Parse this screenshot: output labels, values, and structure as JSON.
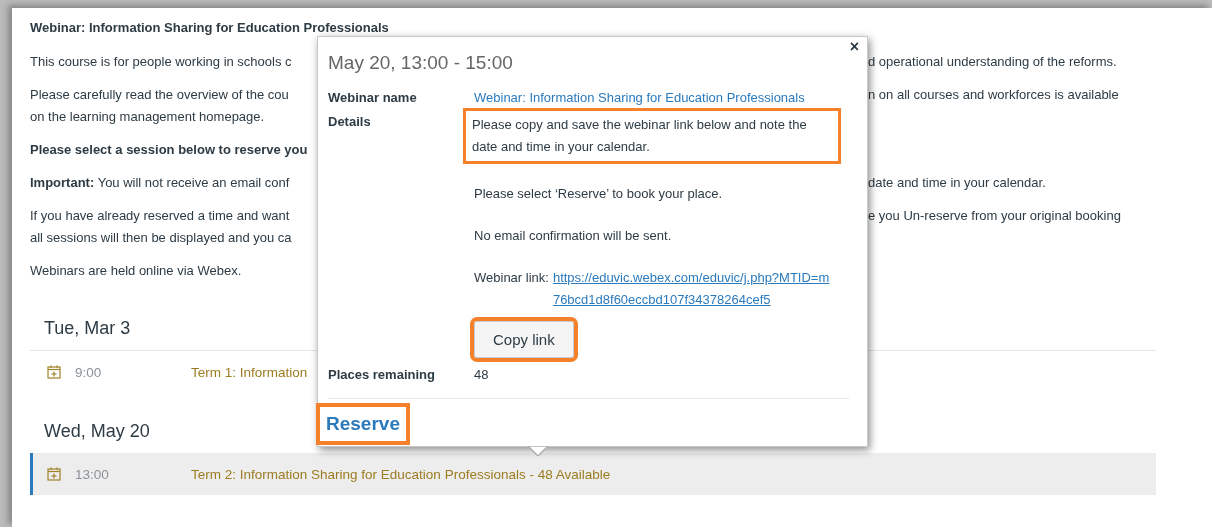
{
  "heading": "Webinar: Information Sharing for Education Professionals",
  "paragraphs": [
    {
      "kind": "plain",
      "left_lines": [
        "This course is for people working in schools c"
      ],
      "right_lines": [
        "d operational understanding of the reforms."
      ]
    },
    {
      "kind": "plain",
      "left_lines": [
        "Please carefully read the overview of the cou",
        "on the learning management homepage."
      ],
      "right_lines": [
        "n on all courses and workforces is available"
      ]
    },
    {
      "kind": "strong",
      "left_lines": [
        "Please select a session below to reserve you"
      ]
    },
    {
      "kind": "plain",
      "left_lines": [
        "**Important:** You will not receive an email conf"
      ],
      "right_lines": [
        "date and time in your calendar."
      ]
    },
    {
      "kind": "plain",
      "left_lines": [
        "If you have already reserved a time and want",
        "all sessions will then be displayed and you ca"
      ],
      "right_lines": [
        "e you Un-reserve from your original booking"
      ]
    },
    {
      "kind": "plain",
      "left_lines": [
        "Webinars are held online via Webex."
      ]
    }
  ],
  "days": [
    {
      "date": "Tue, Mar 3",
      "sessions": [
        {
          "time": "9:00",
          "title": "Term 1: Information",
          "selected": false
        }
      ]
    },
    {
      "date": "Wed, May 20",
      "sessions": [
        {
          "time": "13:00",
          "title": "Term 2: Information Sharing for Education Professionals - 48 Available",
          "selected": true
        }
      ]
    }
  ],
  "popup": {
    "title": "May 20, 13:00 - 15:00",
    "close": "×",
    "webinar_name_label": "Webinar name",
    "webinar_name": "Webinar: Information Sharing for Education Professionals",
    "details_label": "Details",
    "details": [
      {
        "text": "Please copy and save the webinar link below and note the date and time in your calendar.",
        "highlighted": true
      },
      {
        "text": "Please select ‘Reserve’ to book your place.",
        "highlighted": false
      },
      {
        "text": "No email confirmation will be sent.",
        "highlighted": false
      }
    ],
    "link_label": "Webinar link:",
    "link": "https://eduvic.webex.com/eduvic/j.php?MTID=m76bcd1d8f60eccbd107f34378264cef5",
    "copy_button": {
      "label": "Copy link",
      "highlighted": true
    },
    "places_label": "Places remaining",
    "places": "48",
    "reserve_button": {
      "label": "Reserve",
      "highlighted": true
    }
  }
}
